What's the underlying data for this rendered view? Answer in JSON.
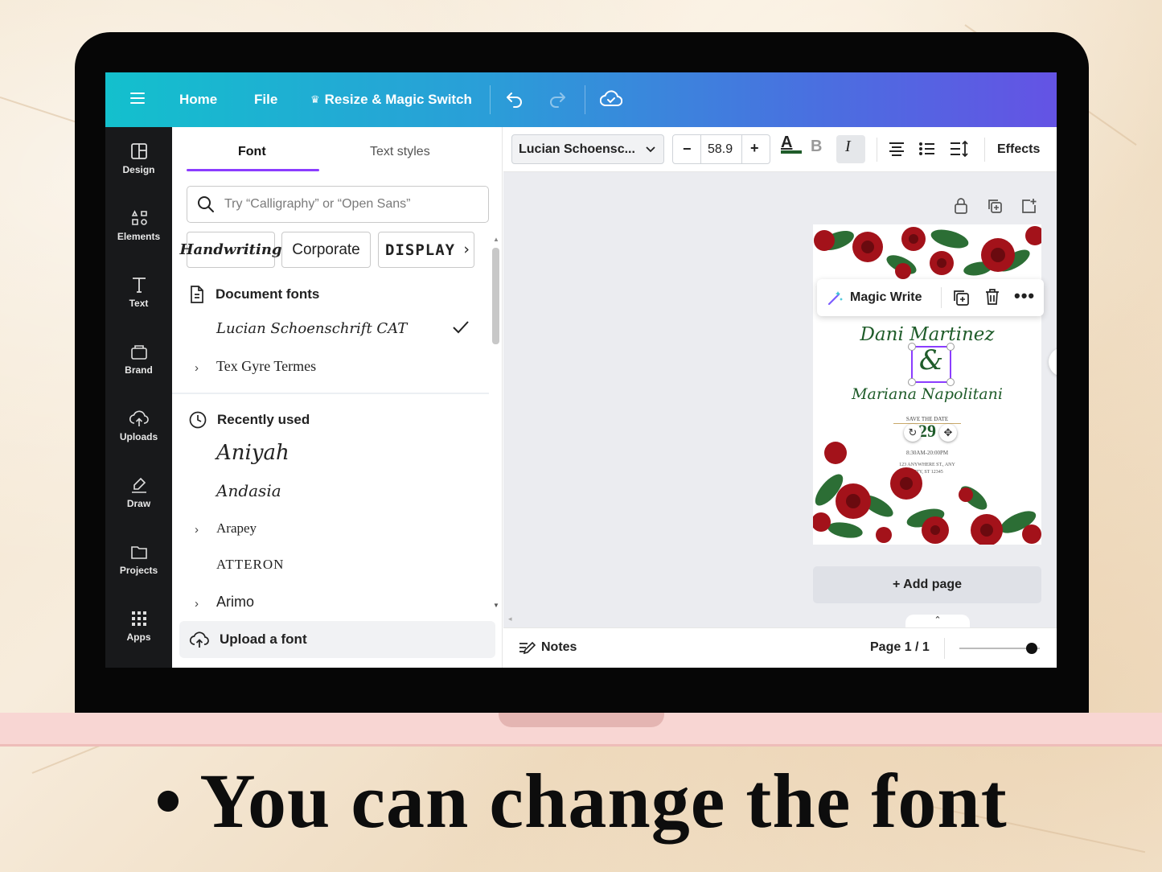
{
  "topbar": {
    "menu_icon": "hamburger-icon",
    "home_label": "Home",
    "file_label": "File",
    "resize_label": "Resize & Magic Switch",
    "undo_icon": "undo-icon",
    "redo_icon": "redo-icon",
    "cloud_icon": "cloud-saved-icon"
  },
  "rail": {
    "items": [
      {
        "label": "Design",
        "icon": "design-icon"
      },
      {
        "label": "Elements",
        "icon": "elements-icon"
      },
      {
        "label": "Text",
        "icon": "text-icon"
      },
      {
        "label": "Brand",
        "icon": "brand-icon"
      },
      {
        "label": "Uploads",
        "icon": "uploads-icon"
      },
      {
        "label": "Draw",
        "icon": "draw-icon"
      },
      {
        "label": "Projects",
        "icon": "projects-icon"
      },
      {
        "label": "Apps",
        "icon": "apps-icon"
      }
    ]
  },
  "panel": {
    "tabs": [
      {
        "label": "Font",
        "active": true
      },
      {
        "label": "Text styles",
        "active": false
      }
    ],
    "search_placeholder": "Try “Calligraphy” or “Open Sans”",
    "chips": [
      "Handwriting",
      "Corporate",
      "DISPLAY"
    ],
    "document_fonts": {
      "heading": "Document fonts",
      "items": [
        {
          "name": "Lucian Schoenschrift CAT",
          "selected": true
        },
        {
          "name": "Tex Gyre Termes",
          "expandable": true
        }
      ]
    },
    "recently_used": {
      "heading": "Recently used",
      "items": [
        {
          "name": "Aniyah"
        },
        {
          "name": "Andasia"
        },
        {
          "name": "Arapey",
          "expandable": true
        },
        {
          "name": "ATTERON"
        },
        {
          "name": "Arimo",
          "expandable": true
        }
      ]
    },
    "upload_label": "Upload a font"
  },
  "toolbar": {
    "font_name": "Lucian Schoensc...",
    "font_size": "58.9",
    "minus": "−",
    "plus": "+",
    "text_color_glyph": "A",
    "bold_glyph": "B",
    "italic_glyph": "I",
    "effects_label": "Effects",
    "text_color": "#1f5c2a"
  },
  "canvas": {
    "magic_write_label": "Magic Write",
    "name1": "Dani Martinez",
    "ampersand": "&",
    "name2": "Mariana Napolitani",
    "save_the_date": "SAVE THE DATE",
    "day": "29",
    "time": "8:30AM-20:00PM",
    "address1": "123 ANYWHERE ST., ANY",
    "address2": "CITY, ST 12345",
    "add_page_label": "+ Add page"
  },
  "footer": {
    "notes_label": "Notes",
    "page_label": "Page 1 / 1",
    "zoom_level": 0.9
  },
  "caption": "• You can change the font",
  "colors": {
    "accent": "#8b3dff",
    "rose": "#b3141c",
    "leaf": "#2c6e35"
  }
}
